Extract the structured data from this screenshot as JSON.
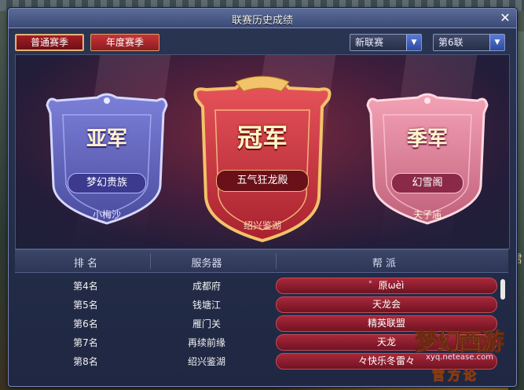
{
  "window": {
    "title": "联赛历史成绩",
    "close_label": "✕"
  },
  "tabs": [
    {
      "label": "普通赛季",
      "selected": true
    },
    {
      "label": "年度赛季",
      "selected": false
    }
  ],
  "filters": {
    "league": {
      "value": "新联赛"
    },
    "round": {
      "value": "第6联"
    }
  },
  "podium": {
    "second": {
      "rank": "亚军",
      "guild": "梦幻贵族",
      "server": "小梅沙"
    },
    "first": {
      "rank": "冠军",
      "guild": "五气狂龙殿",
      "server": "绍兴鉴湖"
    },
    "third": {
      "rank": "季军",
      "guild": "幻雪阁",
      "server": "夫子庙"
    }
  },
  "table": {
    "headers": [
      "排 名",
      "服务器",
      "帮 派"
    ],
    "rows": [
      {
        "rank": "第4名",
        "server": "成都府",
        "guild": "゜原ωèì"
      },
      {
        "rank": "第5名",
        "server": "钱塘江",
        "guild": "天龙会"
      },
      {
        "rank": "第6名",
        "server": "雁门关",
        "guild": "精英联盟"
      },
      {
        "rank": "第7名",
        "server": "再续前缘",
        "guild": "天龙"
      },
      {
        "rank": "第8名",
        "server": "绍兴鉴湖",
        "guild": "々快乐冬雷々"
      }
    ]
  },
  "background": {
    "side_text": "任君"
  },
  "logo": {
    "title": "梦幻西游",
    "subtitle": "官方论",
    "url": "xyq.netease.com"
  },
  "colors": {
    "accent_red": "#a8283a",
    "frame_blue": "#3b4a76",
    "gold": "#f2c36a"
  }
}
